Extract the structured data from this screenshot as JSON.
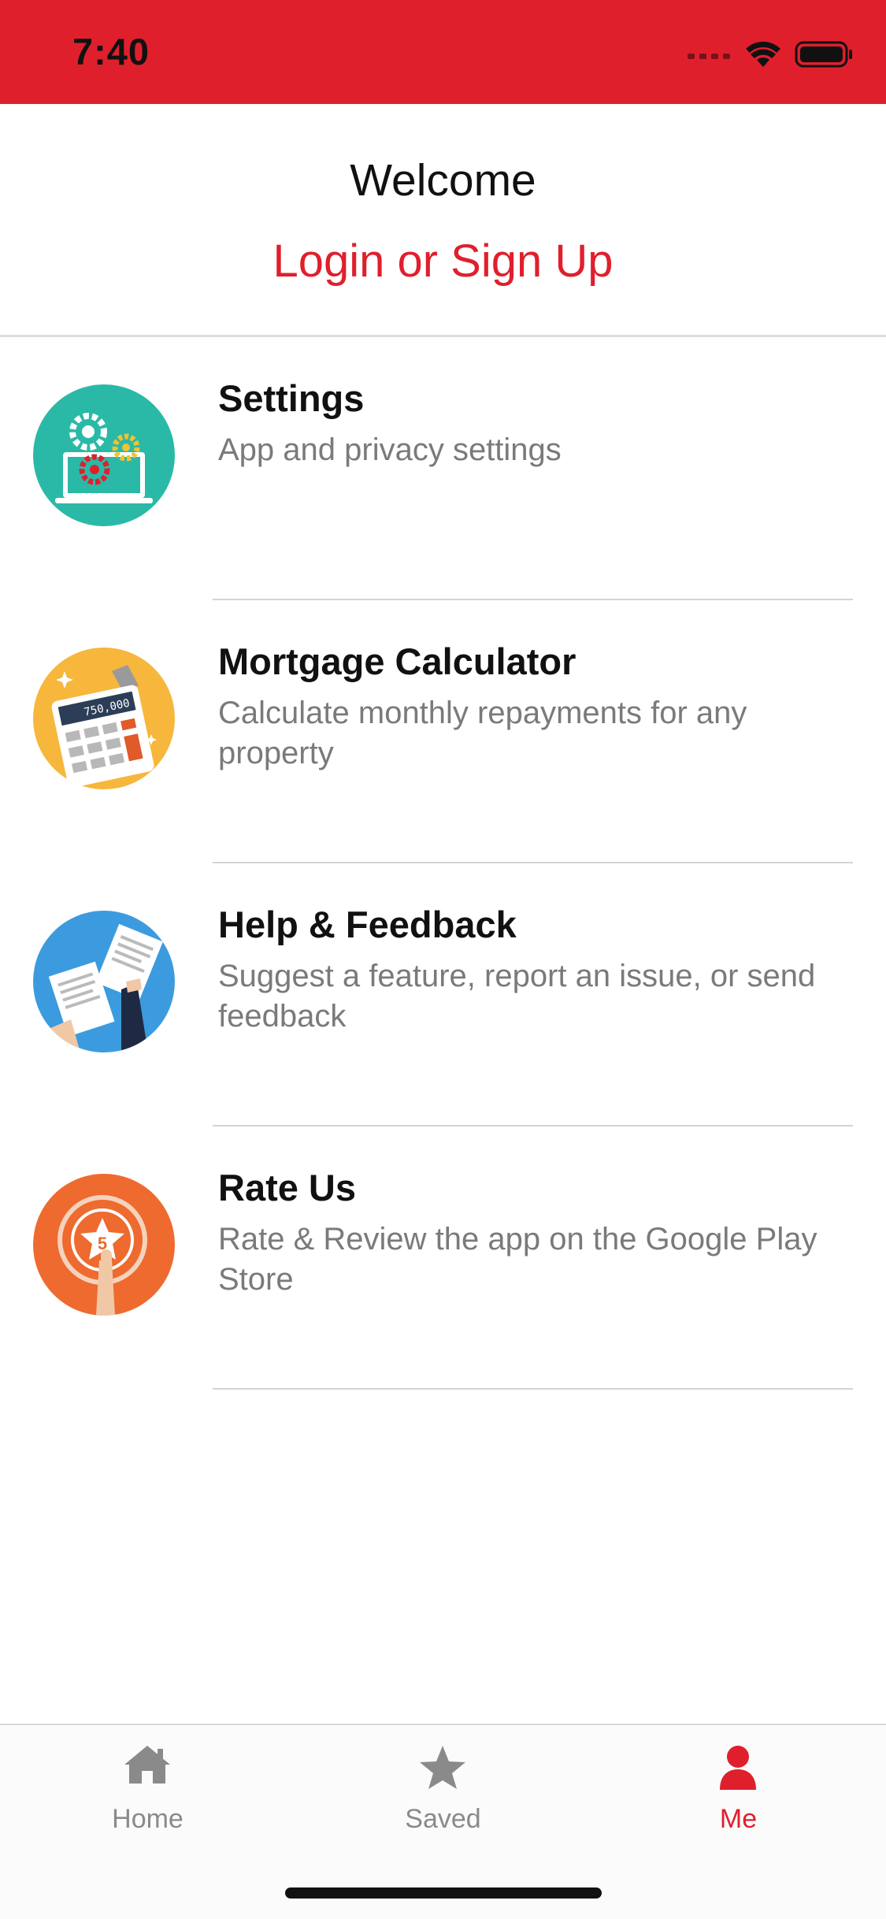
{
  "status_bar": {
    "time": "7:40",
    "color": "#e01f2d",
    "icons": [
      "cellular-icon",
      "wifi-icon",
      "battery-icon"
    ]
  },
  "header": {
    "welcome": "Welcome",
    "login_link": "Login or Sign Up"
  },
  "menu": {
    "items": [
      {
        "icon": "settings-gears-icon",
        "title": "Settings",
        "subtitle": "App and privacy settings"
      },
      {
        "icon": "calculator-icon",
        "title": "Mortgage Calculator",
        "subtitle": "Calculate monthly repayments for any property"
      },
      {
        "icon": "feedback-papers-icon",
        "title": "Help & Feedback",
        "subtitle": "Suggest a feature, report an issue, or send feedback"
      },
      {
        "icon": "rating-star-icon",
        "title": "Rate Us",
        "subtitle": "Rate & Review the app on the Google Play Store"
      }
    ]
  },
  "rate_badge_number": "5",
  "calculator_display": "750,000",
  "tab_bar": {
    "tabs": [
      {
        "label": "Home",
        "icon": "home-icon",
        "active": false
      },
      {
        "label": "Saved",
        "icon": "star-icon",
        "active": false
      },
      {
        "label": "Me",
        "icon": "person-icon",
        "active": true
      }
    ],
    "active_color": "#e01f2d",
    "inactive_color": "#8a8a8a"
  }
}
